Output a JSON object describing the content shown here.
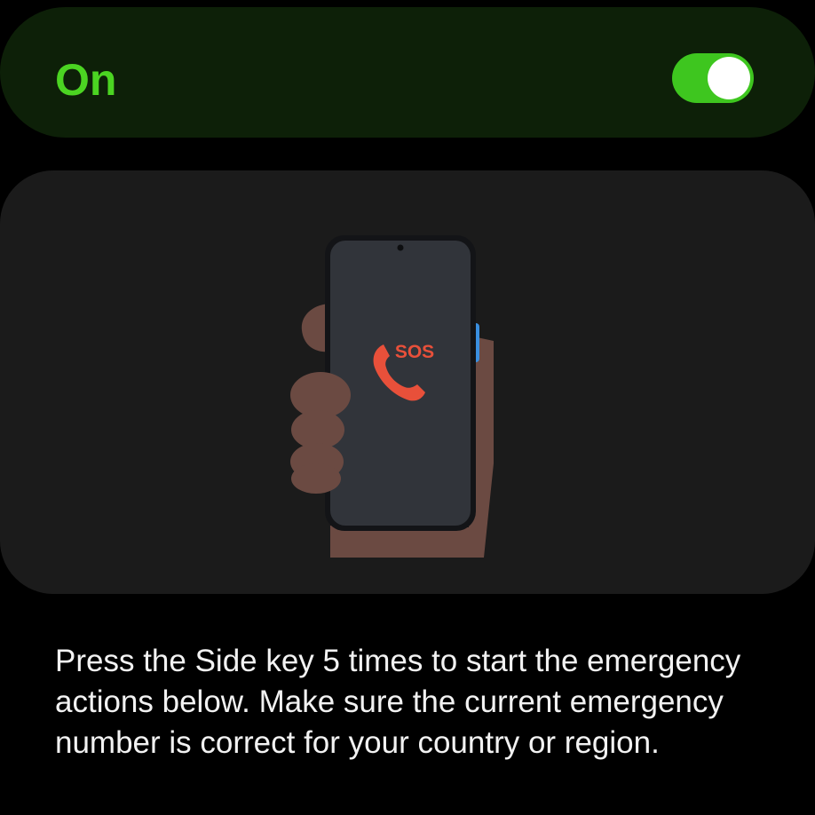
{
  "master_switch": {
    "label": "On",
    "state": "on",
    "accent_color": "#3ec61f"
  },
  "illustration": {
    "screen_text": "SOS",
    "icon": "phone-handset-icon",
    "sos_color": "#e8503a",
    "side_key_color": "#3a8fe0"
  },
  "description": {
    "text": "Press the Side key 5 times to start the emergency actions below. Make sure the current emergency number is correct for your country or region."
  }
}
